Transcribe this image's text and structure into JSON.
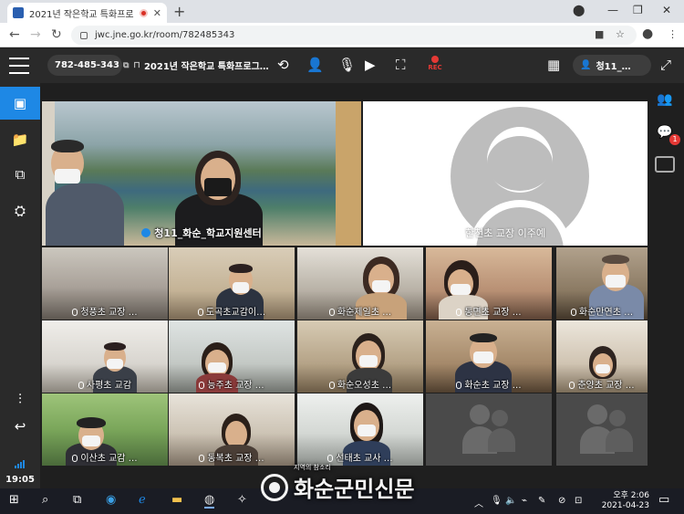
{
  "browser": {
    "tab_title": "2021년 작은학교 특화프로그",
    "tab_close": "✕",
    "new_tab": "+",
    "url": "jwc.jne.go.kr/room/782485343",
    "minimize": "—",
    "restore": "❐",
    "close": "✕"
  },
  "meeting": {
    "room_id": "782-485-343",
    "room_title": "2021년 작은학교 특화프로그…",
    "rec_label": "REC",
    "user_name": "청11_…"
  },
  "sidebar": {
    "time": "19:05"
  },
  "notifications": {
    "chat_count": "1"
  },
  "main_tiles": [
    {
      "label": "청11_화순_학교지원센터",
      "speaking": true
    },
    {
      "label": "한천초 교장 이주예"
    }
  ],
  "grid_tiles": [
    {
      "label": "청풍초 교장 …"
    },
    {
      "label": "도곡초교감이…"
    },
    {
      "label": "화순제일초 …"
    },
    {
      "label": "동면초 교장 …"
    },
    {
      "label": "화순만연초 …"
    },
    {
      "label": "사평초 교감"
    },
    {
      "label": "능주초 교장 …"
    },
    {
      "label": "화순오성초 …"
    },
    {
      "label": "화순초 교장 …"
    },
    {
      "label": "춘양초 교장 …"
    },
    {
      "label": "이산초 교감 …"
    },
    {
      "label": "동복초 교장 …"
    },
    {
      "label": "선태초 교사 …"
    }
  ],
  "taskbar": {
    "time": "오후 2:06",
    "date": "2021-04-23"
  },
  "watermark": {
    "small": "지역의 참소리",
    "name": "화순군민신문"
  },
  "colors": {
    "accent": "#1e88e5",
    "toolbar": "#2a2a2a",
    "record": "#e53935"
  }
}
